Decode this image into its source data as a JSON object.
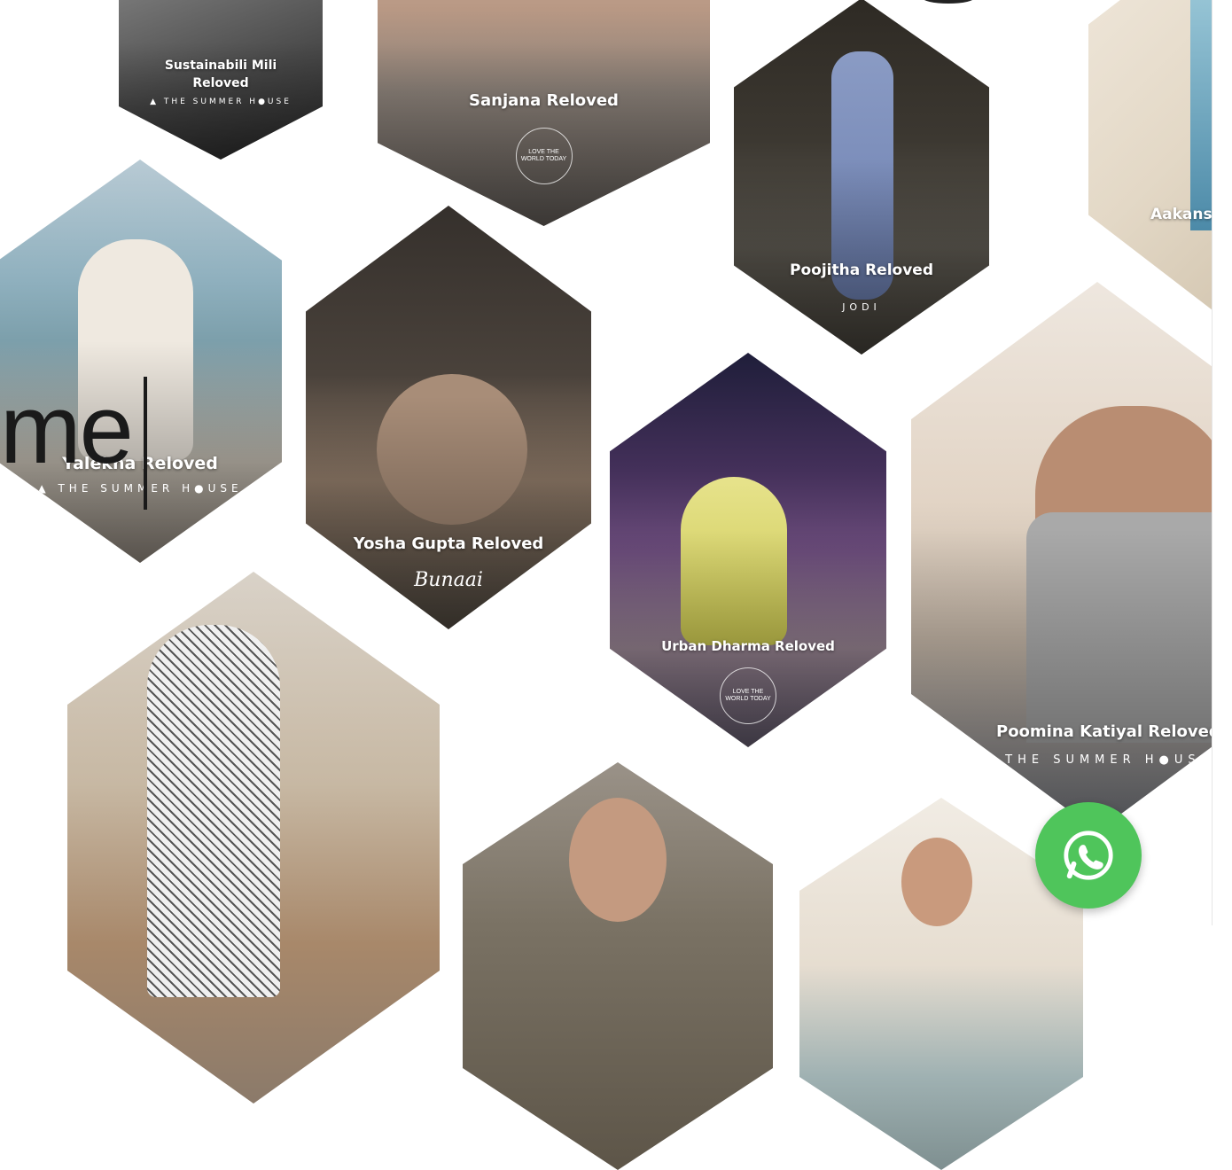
{
  "cards": [
    {
      "caption": "Sustainabili Mili Reloved",
      "brand": "▲ THE SUMMER H●USE"
    },
    {
      "caption": "Sanjana Reloved",
      "stamp": "LOVE THE WORLD TODAY"
    },
    {
      "caption": "Poojitha Reloved",
      "brand": "JODI"
    },
    {
      "caption": "Aakans"
    },
    {
      "caption": "Yalekha Reloved",
      "brand": "▲ THE SUMMER H●USE"
    },
    {
      "caption": "Yosha Gupta Reloved",
      "logo": "Bunaai"
    },
    {
      "caption": "Urban Dharma Reloved",
      "stamp": "LOVE THE WORLD TODAY"
    },
    {
      "caption": "Poomina Katiyal Reloved",
      "brand": "▲ THE SUMMER H●USE"
    },
    {
      "caption": ""
    },
    {
      "caption": ""
    },
    {
      "caption": ""
    }
  ],
  "overlay": {
    "text": "me"
  },
  "whatsapp": {
    "icon": "whatsapp-icon",
    "color": "#4fc55b"
  }
}
